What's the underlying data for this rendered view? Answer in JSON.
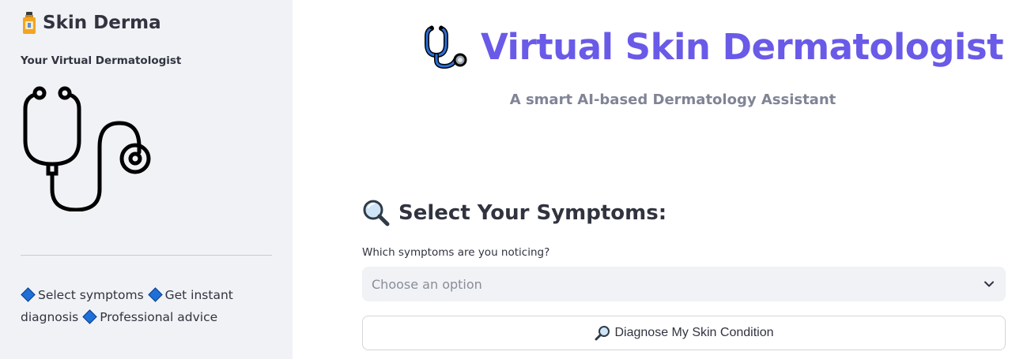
{
  "sidebar": {
    "brand_icon": "medicine-bottle-icon",
    "brand_title": "Skin Derma",
    "tagline": "Your Virtual Dermatologist",
    "illustration": "stethoscope-icon",
    "features": [
      {
        "icon": "blue-diamond-icon",
        "label": "Select symptoms"
      },
      {
        "icon": "blue-diamond-icon",
        "label": "Get instant diagnosis"
      },
      {
        "icon": "blue-diamond-icon",
        "label": "Professional advice"
      }
    ]
  },
  "main": {
    "hero_icon": "stethoscope-icon",
    "title": "Virtual Skin Dermatologist",
    "subtitle": "A smart AI-based Dermatology Assistant",
    "section_icon": "magnifying-glass-icon",
    "section_title": "Select Your Symptoms:",
    "symptoms_label": "Which symptoms are you noticing?",
    "symptoms_placeholder": "Choose an option",
    "diagnose_icon": "magnifying-glass-icon",
    "diagnose_label": "Diagnose My Skin Condition"
  },
  "colors": {
    "sidebar_bg": "#f0f2f6",
    "title": "#6a5ae8",
    "subtitle": "#808495",
    "text": "#31333f",
    "diamond": "#1f6fd6"
  }
}
